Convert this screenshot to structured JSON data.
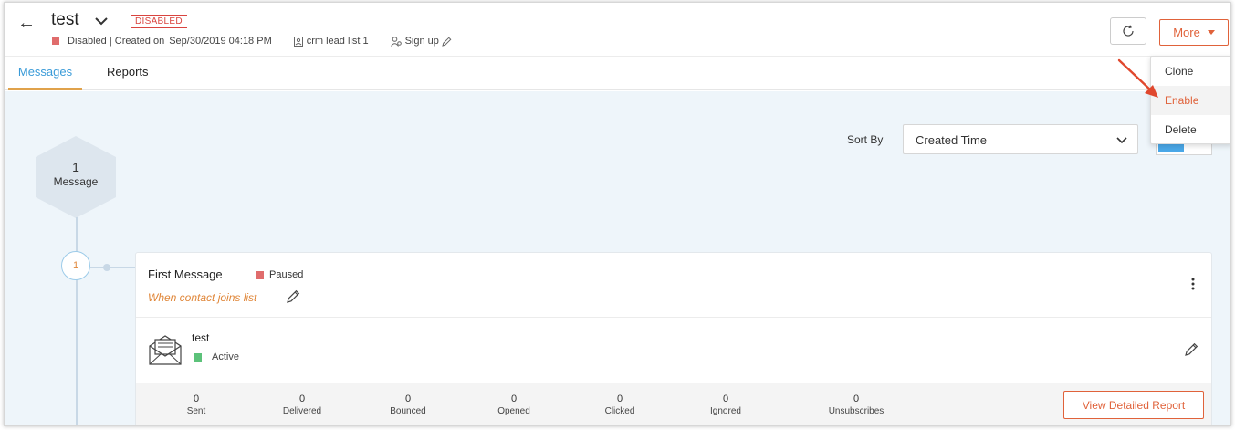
{
  "header": {
    "title": "test",
    "badge": "DISABLED",
    "status": "Disabled | Created on",
    "created_on": "Sep/30/2019 04:18 PM",
    "list_name": "crm lead list 1",
    "signup_label": "Sign up",
    "more_label": "More"
  },
  "tabs": [
    {
      "label": "Messages",
      "active": true
    },
    {
      "label": "Reports",
      "active": false
    }
  ],
  "menu": {
    "items": [
      {
        "label": "Clone"
      },
      {
        "label": "Enable",
        "highlighted": true
      },
      {
        "label": "Delete"
      }
    ]
  },
  "sort": {
    "label": "Sort By",
    "value": "Created Time"
  },
  "summary": {
    "count": "1",
    "label": "Message"
  },
  "step": {
    "number": "1"
  },
  "card": {
    "title": "First Message",
    "status": "Paused",
    "trigger": "When contact joins list",
    "email_name": "test",
    "email_status": "Active",
    "report_button": "View Detailed Report",
    "stats": [
      {
        "value": "0",
        "label": "Sent"
      },
      {
        "value": "0",
        "label": "Delivered"
      },
      {
        "value": "0",
        "label": "Bounced"
      },
      {
        "value": "0",
        "label": "Opened"
      },
      {
        "value": "0",
        "label": "Clicked"
      },
      {
        "value": "0",
        "label": "Ignored"
      },
      {
        "value": "0",
        "label": "Unsubscribes"
      }
    ]
  },
  "colors": {
    "accent": "#e0623a",
    "link_blue": "#3a9bd8",
    "paused": "#e06c6c",
    "active": "#5cc27a"
  }
}
